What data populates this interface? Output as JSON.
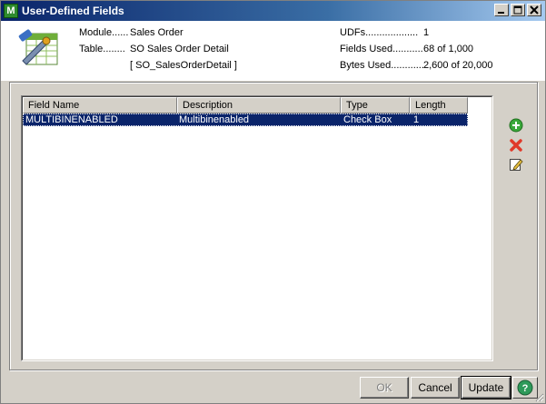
{
  "window": {
    "title": "User-Defined Fields",
    "app_icon_letter": "M",
    "controls": [
      "minimize",
      "maximize",
      "close"
    ]
  },
  "header": {
    "module_label": "Module......",
    "module_value": "Sales Order",
    "table_label": "Table........",
    "table_value": "SO Sales Order Detail",
    "table_name": "[ SO_SalesOrderDetail ]",
    "udfs_label": "UDFs...................",
    "udfs_value": "1",
    "fields_used_label": "Fields Used...........",
    "fields_used_value": "68 of 1,000",
    "bytes_used_label": "Bytes Used............",
    "bytes_used_value": "2,600 of 20,000"
  },
  "grid": {
    "columns": [
      "Field Name",
      "Description",
      "Type",
      "Length"
    ],
    "rows": [
      {
        "field_name": "MULTIBINENABLED",
        "description": "Multibinenabled",
        "type": "Check Box",
        "length": "1",
        "selected": true
      }
    ]
  },
  "side_actions": {
    "add": "add-icon",
    "delete": "delete-icon",
    "edit": "edit-icon"
  },
  "buttons": {
    "ok": "OK",
    "cancel": "Cancel",
    "update": "Update",
    "help": "help-icon"
  },
  "colors": {
    "title_bar": "#0a246a",
    "selection": "#0a246a",
    "face": "#d4d0c8"
  }
}
